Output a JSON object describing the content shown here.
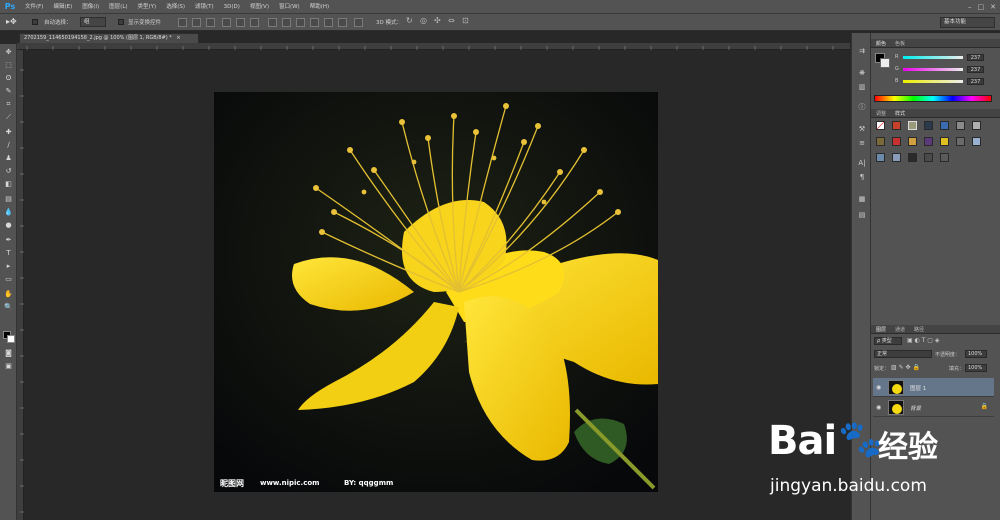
{
  "app": {
    "logo": "Ps",
    "menus": [
      "文件(F)",
      "编辑(E)",
      "图像(I)",
      "图层(L)",
      "类型(Y)",
      "选择(S)",
      "滤镜(T)",
      "3D(D)",
      "视图(V)",
      "窗口(W)",
      "帮助(H)"
    ],
    "window_controls": [
      "–",
      "□",
      "✕"
    ]
  },
  "options": {
    "auto_select_label": "自动选择：",
    "auto_select_value": "组",
    "show_transform_label": "显示变换控件",
    "mode3d_label": "3D 模式：",
    "workspace": "基本功能"
  },
  "document": {
    "tab_title": "2702159_114650194158_2.jpg @ 100% (图层 1, RGB/8#) *",
    "close_icon": "×",
    "watermark_site_cn": "昵图网",
    "watermark_url": "www.nipic.com",
    "watermark_by": "BY: qqggmm"
  },
  "color_panel": {
    "tabs": [
      "颜色",
      "色板"
    ],
    "r_label": "R",
    "r_value": "237",
    "g_label": "G",
    "g_value": "237",
    "b_label": "B",
    "b_value": "237"
  },
  "styles_panel": {
    "tabs": [
      "调整",
      "样式"
    ]
  },
  "layers_panel": {
    "tabs": [
      "图层",
      "通道",
      "路径"
    ],
    "kind_filter": "ρ 类型",
    "blend_mode": "正常",
    "opacity_label": "不透明度：",
    "opacity_value": "100%",
    "lock_label": "锁定：",
    "fill_label": "填充：",
    "fill_value": "100%",
    "layers": [
      {
        "name": "图层 1",
        "selected": true
      },
      {
        "name": "背景",
        "locked": true
      }
    ]
  },
  "overlay": {
    "brand_a": "Bai",
    "brand_b": "经验",
    "url": "jingyan.baidu.com"
  },
  "colors": {
    "chrome": "#535353",
    "canvas_bg": "#282828",
    "flower": "#f5d90f",
    "accent": "#31a8ff"
  }
}
